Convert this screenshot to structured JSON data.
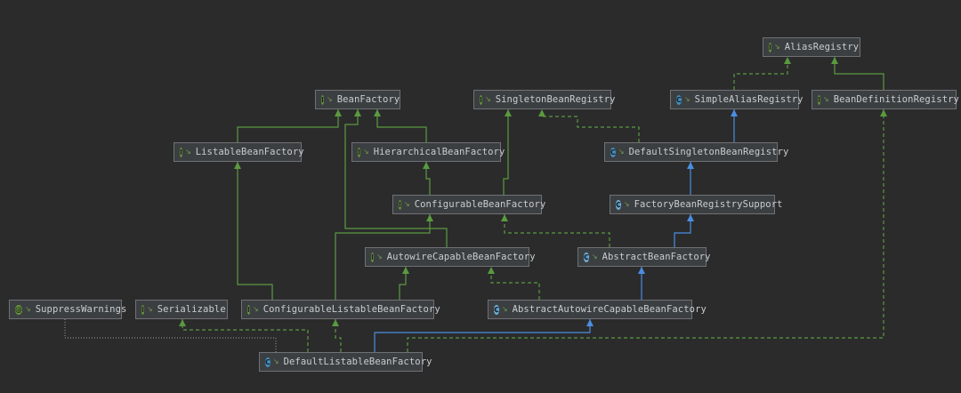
{
  "diagram": {
    "colors": {
      "background": "#2b2b2c",
      "extends_edge": "#5a9a3f",
      "implements_edge": "#5a9a3f",
      "class_inherit_edge": "#4a8ee0",
      "interface_badge": "#6a9e3d",
      "class_badge": "#3e8fc2",
      "annotation_badge": "#6a9e3d"
    },
    "nodes": [
      {
        "id": "AliasRegistry",
        "label": "AliasRegistry",
        "kind": "interface",
        "badge": "I",
        "icon": "interface-icon"
      },
      {
        "id": "BeanFactory",
        "label": "BeanFactory",
        "kind": "interface",
        "badge": "I",
        "icon": "interface-icon"
      },
      {
        "id": "SingletonBeanRegistry",
        "label": "SingletonBeanRegistry",
        "kind": "interface",
        "badge": "I",
        "icon": "interface-icon"
      },
      {
        "id": "SimpleAliasRegistry",
        "label": "SimpleAliasRegistry",
        "kind": "class",
        "badge": "C",
        "icon": "class-icon"
      },
      {
        "id": "BeanDefinitionRegistry",
        "label": "BeanDefinitionRegistry",
        "kind": "interface",
        "badge": "I",
        "icon": "interface-icon"
      },
      {
        "id": "ListableBeanFactory",
        "label": "ListableBeanFactory",
        "kind": "interface",
        "badge": "I",
        "icon": "interface-icon"
      },
      {
        "id": "HierarchicalBeanFactory",
        "label": "HierarchicalBeanFactory",
        "kind": "interface",
        "badge": "I",
        "icon": "interface-icon"
      },
      {
        "id": "DefaultSingletonBeanRegistry",
        "label": "DefaultSingletonBeanRegistry",
        "kind": "class",
        "badge": "C",
        "icon": "class-icon"
      },
      {
        "id": "ConfigurableBeanFactory",
        "label": "ConfigurableBeanFactory",
        "kind": "interface",
        "badge": "I",
        "icon": "interface-icon"
      },
      {
        "id": "FactoryBeanRegistrySupport",
        "label": "FactoryBeanRegistrySupport",
        "kind": "abstract",
        "badge": "C",
        "icon": "abstract-class-icon"
      },
      {
        "id": "AutowireCapableBeanFactory",
        "label": "AutowireCapableBeanFactory",
        "kind": "interface",
        "badge": "I",
        "icon": "interface-icon"
      },
      {
        "id": "AbstractBeanFactory",
        "label": "AbstractBeanFactory",
        "kind": "abstract",
        "badge": "C",
        "icon": "abstract-class-icon"
      },
      {
        "id": "SuppressWarnings",
        "label": "SuppressWarnings",
        "kind": "annotation",
        "badge": "@",
        "icon": "annotation-icon"
      },
      {
        "id": "Serializable",
        "label": "Serializable",
        "kind": "interface",
        "badge": "I",
        "icon": "interface-icon"
      },
      {
        "id": "ConfigurableListableBeanFactory",
        "label": "ConfigurableListableBeanFactory",
        "kind": "interface",
        "badge": "I",
        "icon": "interface-icon"
      },
      {
        "id": "AbstractAutowireCapableBeanFactory",
        "label": "AbstractAutowireCapableBeanFactory",
        "kind": "abstract",
        "badge": "C",
        "icon": "abstract-class-icon"
      },
      {
        "id": "DefaultListableBeanFactory",
        "label": "DefaultListableBeanFactory",
        "kind": "class",
        "badge": "C",
        "icon": "class-icon"
      }
    ],
    "edges": [
      {
        "from": "SimpleAliasRegistry",
        "to": "AliasRegistry",
        "type": "implements"
      },
      {
        "from": "BeanDefinitionRegistry",
        "to": "AliasRegistry",
        "type": "extends"
      },
      {
        "from": "ListableBeanFactory",
        "to": "BeanFactory",
        "type": "extends"
      },
      {
        "from": "HierarchicalBeanFactory",
        "to": "BeanFactory",
        "type": "extends"
      },
      {
        "from": "DefaultSingletonBeanRegistry",
        "to": "SingletonBeanRegistry",
        "type": "implements"
      },
      {
        "from": "DefaultSingletonBeanRegistry",
        "to": "SimpleAliasRegistry",
        "type": "class-extends"
      },
      {
        "from": "ConfigurableBeanFactory",
        "to": "HierarchicalBeanFactory",
        "type": "extends"
      },
      {
        "from": "ConfigurableBeanFactory",
        "to": "SingletonBeanRegistry",
        "type": "extends"
      },
      {
        "from": "FactoryBeanRegistrySupport",
        "to": "DefaultSingletonBeanRegistry",
        "type": "class-extends"
      },
      {
        "from": "AutowireCapableBeanFactory",
        "to": "BeanFactory",
        "type": "extends"
      },
      {
        "from": "AbstractBeanFactory",
        "to": "FactoryBeanRegistrySupport",
        "type": "class-extends"
      },
      {
        "from": "AbstractBeanFactory",
        "to": "ConfigurableBeanFactory",
        "type": "implements"
      },
      {
        "from": "ConfigurableListableBeanFactory",
        "to": "ListableBeanFactory",
        "type": "extends"
      },
      {
        "from": "ConfigurableListableBeanFactory",
        "to": "ConfigurableBeanFactory",
        "type": "extends"
      },
      {
        "from": "ConfigurableListableBeanFactory",
        "to": "AutowireCapableBeanFactory",
        "type": "extends"
      },
      {
        "from": "AbstractAutowireCapableBeanFactory",
        "to": "AbstractBeanFactory",
        "type": "class-extends"
      },
      {
        "from": "AbstractAutowireCapableBeanFactory",
        "to": "AutowireCapableBeanFactory",
        "type": "implements"
      },
      {
        "from": "DefaultListableBeanFactory",
        "to": "AbstractAutowireCapableBeanFactory",
        "type": "class-extends"
      },
      {
        "from": "DefaultListableBeanFactory",
        "to": "ConfigurableListableBeanFactory",
        "type": "implements"
      },
      {
        "from": "DefaultListableBeanFactory",
        "to": "Serializable",
        "type": "implements"
      },
      {
        "from": "DefaultListableBeanFactory",
        "to": "BeanDefinitionRegistry",
        "type": "implements"
      },
      {
        "from": "DefaultListableBeanFactory",
        "to": "SuppressWarnings",
        "type": "annotation"
      }
    ]
  }
}
